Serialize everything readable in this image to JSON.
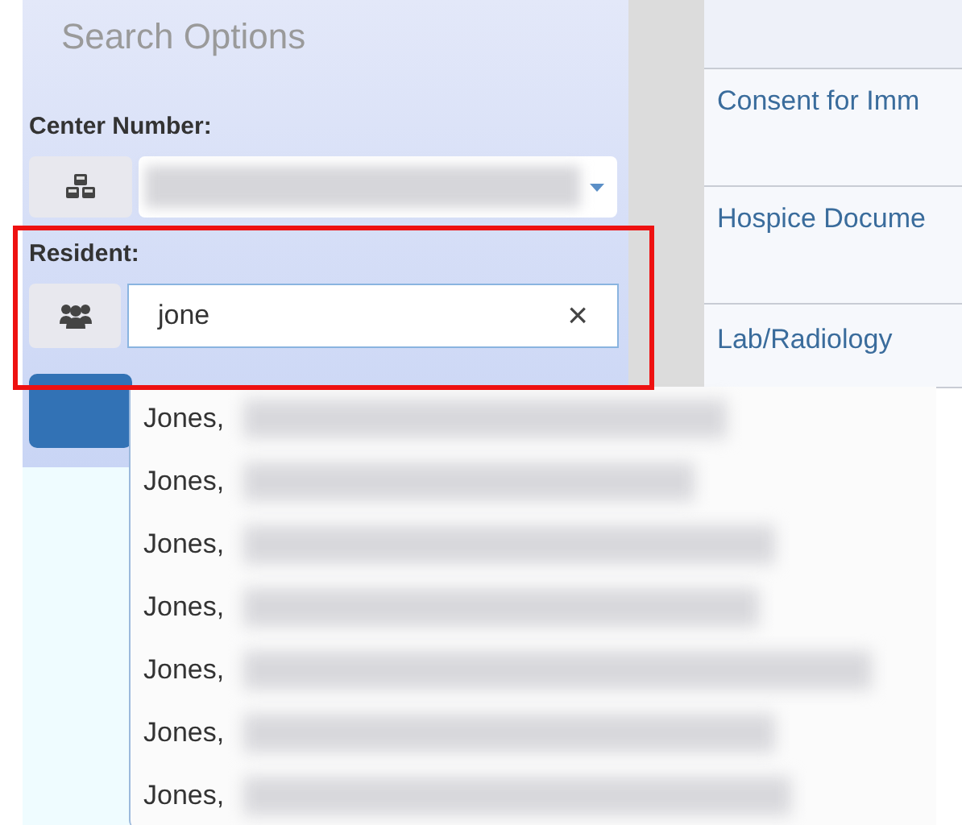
{
  "search_options": {
    "title": "Search Options",
    "center_number": {
      "label": "Center Number:"
    },
    "resident": {
      "label": "Resident:",
      "value": "jone",
      "clear": "×"
    },
    "suggestions": [
      {
        "text": "Jones,"
      },
      {
        "text": "Jones,"
      },
      {
        "text": "Jones,"
      },
      {
        "text": "Jones,"
      },
      {
        "text": "Jones,"
      },
      {
        "text": "Jones,"
      },
      {
        "text": "Jones,"
      }
    ]
  },
  "documents": {
    "rows": [
      {
        "name": "Consent for Imm"
      },
      {
        "name": "Hospice Docume"
      },
      {
        "name": "Lab/Radiology"
      }
    ]
  }
}
